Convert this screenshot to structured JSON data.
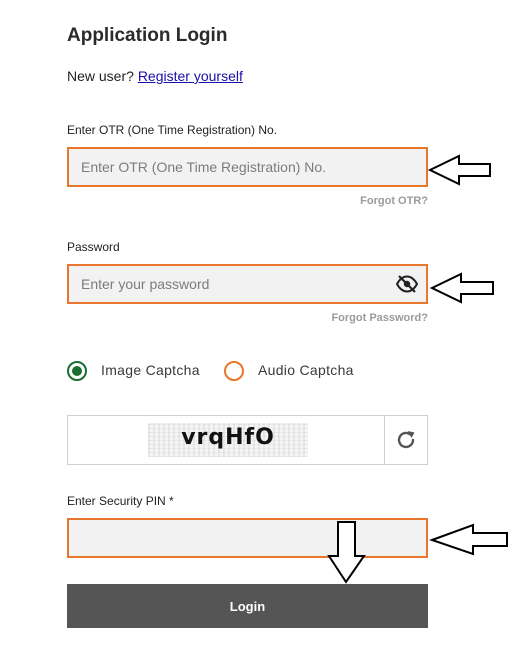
{
  "form": {
    "title": "Application Login",
    "new_user_text": "New user?",
    "register_link": "Register yourself",
    "otr": {
      "label": "Enter OTR (One Time Registration) No.",
      "placeholder": "Enter OTR (One Time Registration) No.",
      "value": "",
      "forgot_link": "Forgot OTR?"
    },
    "password": {
      "label": "Password",
      "placeholder": "Enter your password",
      "value": "",
      "visibility_icon": "eye-off-icon",
      "forgot_link": "Forgot Password?"
    },
    "captcha": {
      "options": [
        {
          "label": "Image Captcha",
          "selected": true
        },
        {
          "label": "Audio Captcha",
          "selected": false
        }
      ],
      "image_text": "vrqHfO",
      "refresh_icon": "refresh-icon"
    },
    "security_pin": {
      "label": "Enter Security PIN *",
      "value": ""
    },
    "login_label": "Login"
  },
  "colors": {
    "accent_orange": "#e8762d",
    "radio_green": "#1b6e2f",
    "button_gray": "#555555",
    "link_blue": "#1a0dab",
    "field_bg": "#f2f2f2"
  }
}
